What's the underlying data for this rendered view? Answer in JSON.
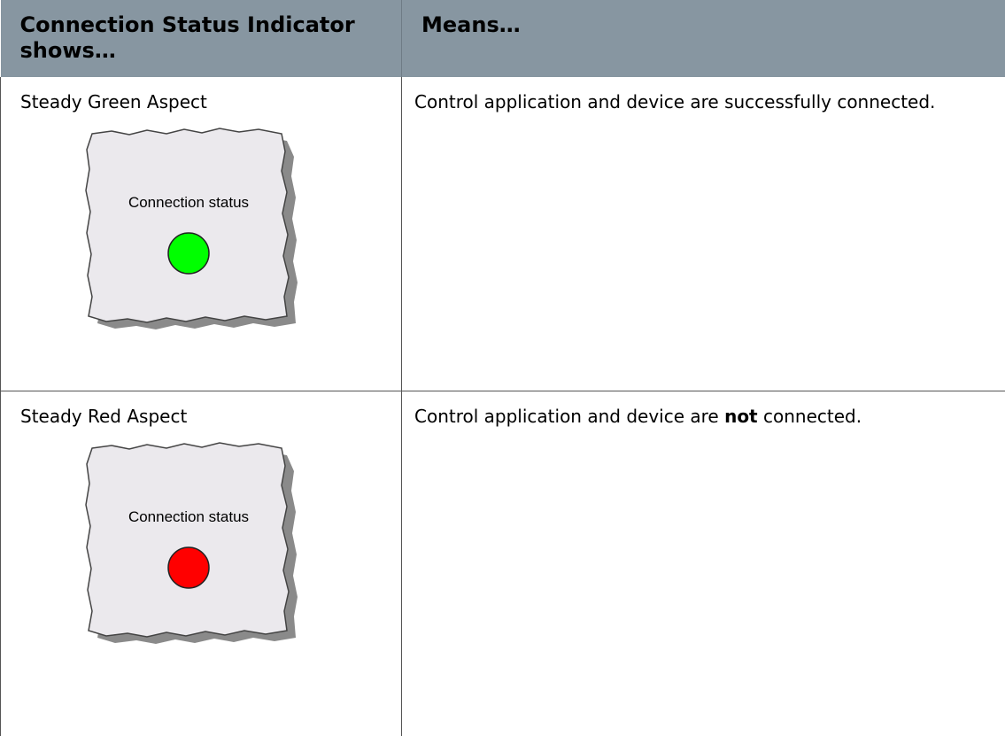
{
  "table": {
    "headers": [
      "Connection Status Indicator shows…",
      "Means…"
    ],
    "rows": [
      {
        "aspect": "Steady Green Aspect",
        "indicator_caption": "Connection status",
        "indicator_color": "#00ff00",
        "meaning": "Control application and device are successfully connected."
      },
      {
        "aspect": "Steady Red Aspect",
        "indicator_caption": "Connection status",
        "indicator_color": "#ff0000",
        "meaning_before": "Control application and device are ",
        "meaning_bold": "not",
        "meaning_after": " connected."
      }
    ]
  },
  "colors": {
    "header_background": "#8796a1",
    "panel_background": "#ebe9ed"
  }
}
